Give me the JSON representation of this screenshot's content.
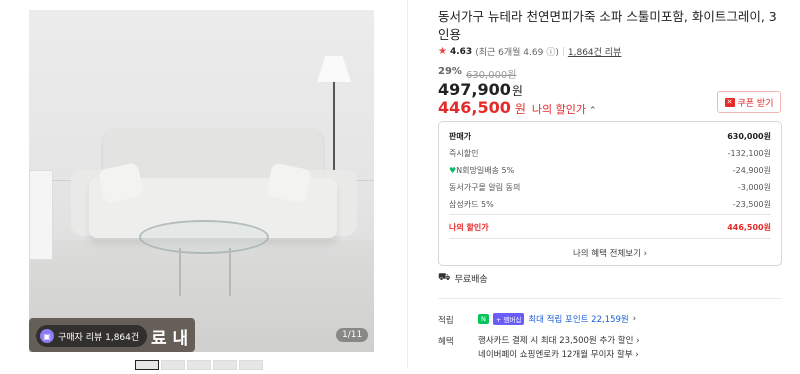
{
  "gallery": {
    "promo_text": "료 내림",
    "review_chip": "구매자 리뷰 1,864건",
    "page_indicator": "1/11"
  },
  "product": {
    "title": "동서가구 뉴테라 천연면피가죽 소파 스툴미포함, 화이트그레이, 3인용",
    "rating": "4.63",
    "rating_detail": "(최근 6개월 4.69",
    "reviews": "1,864건 리뷰",
    "discount_rate": "29%",
    "original_price": "630,000원",
    "price": "497,900",
    "my_price": "446,500",
    "my_price_label": "나의 할인가",
    "coupon_label": "쿠폰 받기",
    "won": "원"
  },
  "breakdown": {
    "header": {
      "label": "판매가",
      "value": "630,000원"
    },
    "rows": [
      {
        "label": "즉시할인",
        "value": "-132,100원"
      },
      {
        "label": "N회망일배송 5%",
        "value": "-24,900원"
      },
      {
        "label": "동서가구몰 알림 동의",
        "value": "-3,000원"
      },
      {
        "label": "삼성카드 5%",
        "value": "-23,500원"
      }
    ],
    "total": {
      "label": "나의 할인가",
      "value": "446,500원"
    },
    "all_benefits": "나의 혜택 전체보기"
  },
  "shipping": {
    "label": "무료배송"
  },
  "points": {
    "label": "적립",
    "npay_badge": "N",
    "membership_badge": "+ 멤버십",
    "text": "최대 적립 포인트 22,159원"
  },
  "benefits": {
    "label": "혜택",
    "line1": "행사카드 결제 시 최대 23,500원 추가 할인",
    "line2": "네이버페이 쇼핑엔로카 12개월 무이자 할부"
  },
  "colors": {
    "accent_red": "#e52a2a",
    "npay_green": "#03c75a",
    "link_blue": "#1b5fd6"
  }
}
